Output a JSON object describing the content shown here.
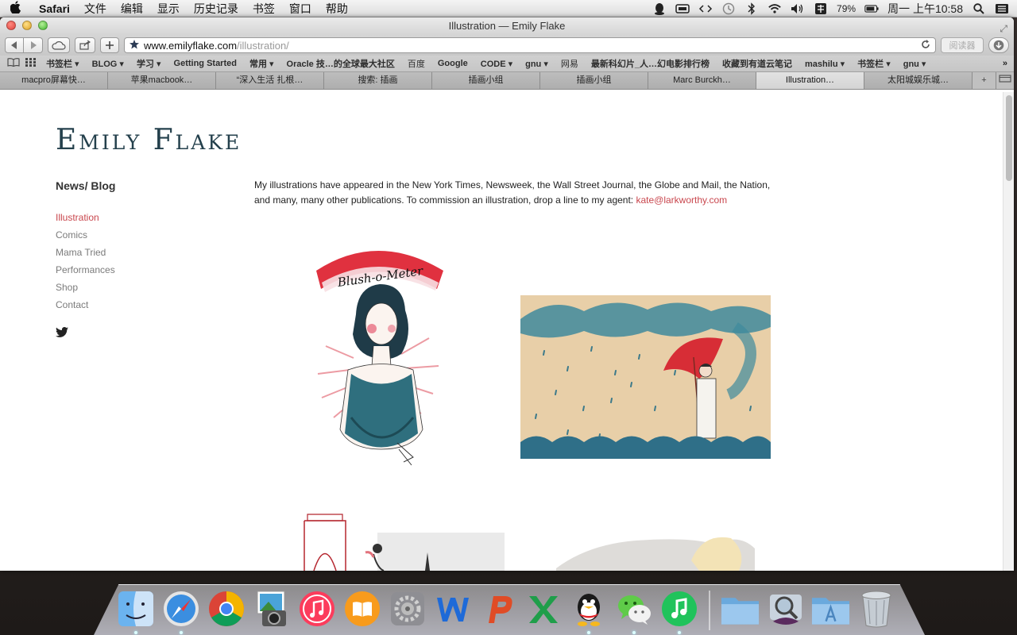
{
  "menubar": {
    "app_name": "Safari",
    "items": [
      "文件",
      "编辑",
      "显示",
      "历史记录",
      "书签",
      "窗口",
      "帮助"
    ],
    "battery": "79%",
    "clock": "周一 上午10:58"
  },
  "window": {
    "title": "Illustration — Emily Flake"
  },
  "toolbar": {
    "url_host": "www.emilyflake.com",
    "url_path": "/illustration/",
    "reader_label": "阅读器"
  },
  "bookmarks": [
    {
      "label": "书签栏 ▾",
      "bold": true
    },
    {
      "label": "BLOG ▾",
      "bold": true
    },
    {
      "label": "学习 ▾",
      "bold": true
    },
    {
      "label": "Getting Started",
      "bold": true
    },
    {
      "label": "常用 ▾",
      "bold": true
    },
    {
      "label": "Oracle 技…的全球最大社区",
      "bold": true
    },
    {
      "label": "百度",
      "bold": false
    },
    {
      "label": "Google",
      "bold": true
    },
    {
      "label": "CODE ▾",
      "bold": true
    },
    {
      "label": "gnu ▾",
      "bold": true
    },
    {
      "label": "网易",
      "bold": false
    },
    {
      "label": "最新科幻片_人…幻电影排行榜",
      "bold": true
    },
    {
      "label": "收藏到有道云笔记",
      "bold": true
    },
    {
      "label": "mashilu ▾",
      "bold": true
    },
    {
      "label": "书签栏 ▾",
      "bold": true
    },
    {
      "label": "gnu ▾",
      "bold": true
    }
  ],
  "tabs": [
    {
      "label": "macpro屏幕快…"
    },
    {
      "label": "苹果macbook…"
    },
    {
      "label": "“深入生活 扎根…"
    },
    {
      "label": "搜索: 插画"
    },
    {
      "label": "插画小组"
    },
    {
      "label": "插画小组"
    },
    {
      "label": "Marc Burckh…"
    },
    {
      "label": "Illustration…"
    },
    {
      "label": "太阳城娱乐城…"
    }
  ],
  "page": {
    "logo": "Emily Flake",
    "news_blog": "News/ Blog",
    "nav": [
      {
        "label": "Illustration",
        "active": true
      },
      {
        "label": "Comics",
        "active": false
      },
      {
        "label": "Mama Tried",
        "active": false
      },
      {
        "label": "Performances",
        "active": false
      },
      {
        "label": "Shop",
        "active": false
      },
      {
        "label": "Contact",
        "active": false
      }
    ],
    "intro_text": "My illustrations have appeared in the New York Times, Newsweek, the Wall Street Journal, the Globe and Mail, the Nation, and many, many other publications. To commission an illustration, drop a line to my agent: ",
    "agent_email": "kate@larkworthy.com",
    "illustration_1_banner": "Blush-o-Meter"
  },
  "colors": {
    "accent": "#c9474e",
    "logo": "#24404c"
  },
  "dock": [
    {
      "name": "finder-icon",
      "running": true
    },
    {
      "name": "safari-icon",
      "running": true
    },
    {
      "name": "chrome-icon",
      "running": false
    },
    {
      "name": "iphoto-icon",
      "running": false
    },
    {
      "name": "itunes-icon",
      "running": false
    },
    {
      "name": "ibooks-icon",
      "running": false
    },
    {
      "name": "system-preferences-icon",
      "running": false
    },
    {
      "name": "word-icon",
      "running": false
    },
    {
      "name": "powerpoint-icon",
      "running": false
    },
    {
      "name": "excel-icon",
      "running": false
    },
    {
      "name": "qq-icon",
      "running": true
    },
    {
      "name": "wechat-icon",
      "running": true
    },
    {
      "name": "music-icon",
      "running": true
    },
    {
      "name": "separator"
    },
    {
      "name": "applications-folder-icon",
      "running": false
    },
    {
      "name": "alfred-icon",
      "running": false
    },
    {
      "name": "app-store-folder-icon",
      "running": false
    },
    {
      "name": "trash-icon",
      "running": false
    }
  ]
}
